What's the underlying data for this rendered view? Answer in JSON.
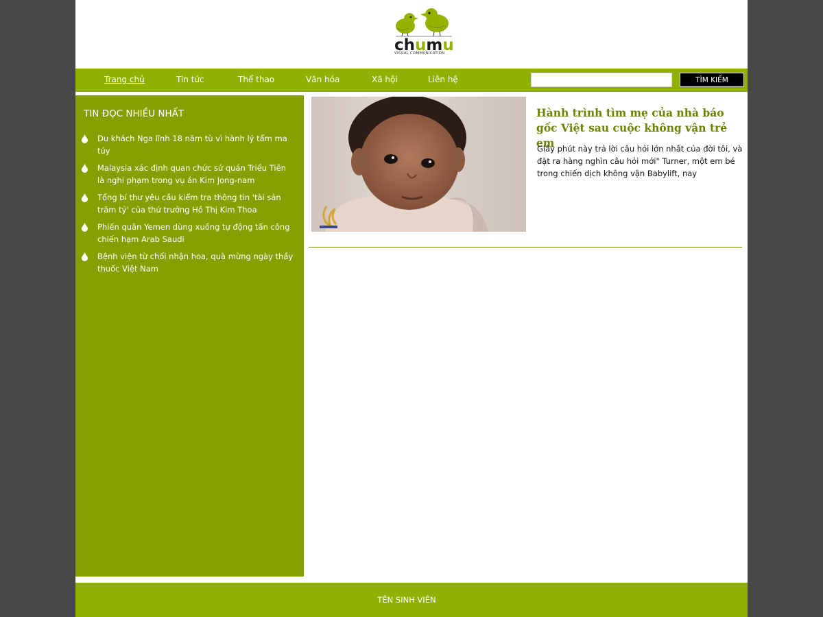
{
  "logo": {
    "word_1": "ch",
    "word_2": "u",
    "word_3": "m",
    "word_4": "u",
    "tagline": "VISUAL COMMUNICATION",
    "accent_color": "#94b300"
  },
  "nav": {
    "items": [
      {
        "label": "Trang chủ",
        "active": true
      },
      {
        "label": "Tin tức"
      },
      {
        "label": "Thể thao"
      },
      {
        "label": "Văn hóa"
      },
      {
        "label": "Xã hội"
      },
      {
        "label": "Liên hệ"
      }
    ],
    "search": {
      "value": "",
      "placeholder": "",
      "button_label": "TÌM KIẾM"
    },
    "bg_color": "#90b103"
  },
  "sidebar": {
    "title": "TIN ĐỌC NHIỀU NHẤT",
    "bg_color": "#84a003",
    "items": [
      {
        "label": "Du khách Nga lĩnh 18 năm tù vì hành lý tẩm ma túy"
      },
      {
        "label": "Malaysia xác định quan chức sứ quán Triều Tiên là nghi phạm trong vụ án Kim Jong-nam"
      },
      {
        "label": "Tổng bí thư yêu cầu kiểm tra thông tin 'tài sản trăm tỷ' của thứ trưởng Hồ Thị Kim Thoa"
      },
      {
        "label": "Phiến quân Yemen dùng xuồng tự động tấn công chiến hạm Arab Saudi"
      },
      {
        "label": "Bệnh viện từ chối nhận hoa, quà mừng ngày thầy thuốc Việt Nam"
      }
    ]
  },
  "article": {
    "title": "Hành trình tìm mẹ của nhà báo gốc Việt sau cuộc không vận trẻ em",
    "summary": "Giây phút này trả lời câu hỏi lớn nhất của đời tôi, và đặt ra hàng nghìn câu hỏi mới\" Turner, một em bé trong chiến dịch không vận Babylift, nay",
    "image_icon": "baby-photo",
    "watermark_icon": "aljazeera-logo-icon",
    "title_color": "#6c8500"
  },
  "footer": {
    "text": "TÊN SINH VIÊN"
  }
}
